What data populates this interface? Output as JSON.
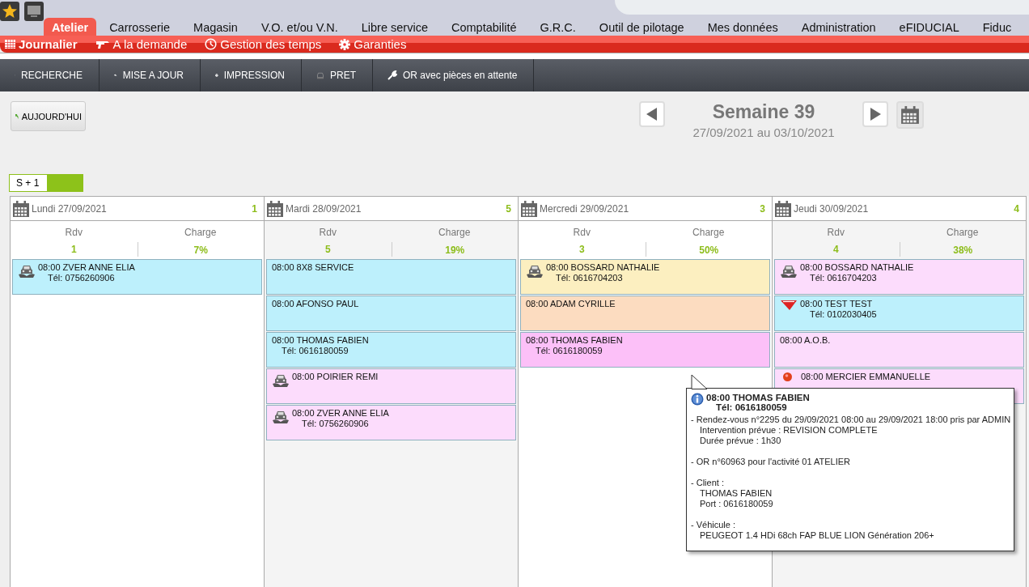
{
  "main_tabs": [
    {
      "label": "Atelier",
      "selected": true
    },
    {
      "label": "Carrosserie",
      "selected": false
    },
    {
      "label": "Magasin",
      "selected": false
    },
    {
      "label": "V.O. et/ou V.N.",
      "selected": false
    },
    {
      "label": "Libre service",
      "selected": false
    },
    {
      "label": "Comptabilité",
      "selected": false
    },
    {
      "label": "G.R.C.",
      "selected": false
    },
    {
      "label": "Outil de pilotage",
      "selected": false
    },
    {
      "label": "Mes données",
      "selected": false
    },
    {
      "label": "Administration",
      "selected": false
    },
    {
      "label": "eFIDUCIAL",
      "selected": false
    },
    {
      "label": "Fiduc",
      "selected": false
    }
  ],
  "sub_tabs": [
    {
      "label": "Journalier",
      "selected": true
    },
    {
      "label": "A la demande",
      "selected": false
    },
    {
      "label": "Gestion des temps",
      "selected": false
    },
    {
      "label": "Garanties",
      "selected": false
    }
  ],
  "toolbar": [
    "RECHERCHE",
    "MISE A JOUR",
    "IMPRESSION",
    "PRET",
    "OR avec pièces en attente"
  ],
  "today_button": "AUJOURD'HUI",
  "week": {
    "title": "Semaine 39",
    "range": "27/09/2021 au 03/10/2021"
  },
  "week_offset": "S + 1",
  "days": [
    {
      "date": "Lundi 27/09/2021",
      "count": "1",
      "rdv_label": "Rdv",
      "rdv": "1",
      "charge_label": "Charge",
      "charge": "7%",
      "appointments": [
        {
          "title": "08:00 ZVER ANNE ELIA",
          "phone": "Tél: 0756260906",
          "kind": "car",
          "color": "#bdf0fc"
        }
      ]
    },
    {
      "date": "Mardi 28/09/2021",
      "count": "5",
      "rdv_label": "Rdv",
      "rdv": "5",
      "charge_label": "Charge",
      "charge": "19%",
      "appointments": [
        {
          "title": "08:00 8X8 SERVICE",
          "kind": "plain",
          "color": "#bdf0fc"
        },
        {
          "title": "08:00 AFONSO PAUL",
          "kind": "plain",
          "color": "#bdf0fc"
        },
        {
          "title": "08:00 THOMAS FABIEN",
          "phone": "Tél: 0616180059",
          "kind": "plain",
          "color": "#bdf0fc"
        },
        {
          "title": "08:00 POIRIER REMI",
          "kind": "car",
          "color": "#fcdcfc"
        },
        {
          "title": "08:00 ZVER ANNE ELIA",
          "phone": "Tél: 0756260906",
          "kind": "car",
          "color": "#fcdcfc"
        }
      ]
    },
    {
      "date": "Mercredi 29/09/2021",
      "count": "3",
      "rdv_label": "Rdv",
      "rdv": "3",
      "charge_label": "Charge",
      "charge": "50%",
      "appointments": [
        {
          "title": "08:00 BOSSARD NATHALIE",
          "phone": "Tél: 0616704203",
          "kind": "car",
          "color": "#fcefc0"
        },
        {
          "title": "08:00 ADAM CYRILLE",
          "kind": "plain",
          "color": "#fcdcc0"
        },
        {
          "title": "08:00 THOMAS FABIEN",
          "phone": "Tél: 0616180059",
          "kind": "plain",
          "color": "#fcc0f8"
        }
      ]
    },
    {
      "date": "Jeudi 30/09/2021",
      "count": "4",
      "rdv_label": "Rdv",
      "rdv": "4",
      "charge_label": "Charge",
      "charge": "38%",
      "appointments": [
        {
          "title": "08:00 BOSSARD NATHALIE",
          "phone": "Tél: 0616704203",
          "kind": "car",
          "color": "#fcdcfc"
        },
        {
          "title": "08:00 TEST TEST",
          "phone": "Tél: 0102030405",
          "kind": "badge",
          "color": "#bdf0fc"
        },
        {
          "title": "08:00 A.O.B.",
          "kind": "plain",
          "color": "#fcdcfc"
        },
        {
          "title": "08:00 MERCIER EMMANUELLE",
          "kind": "dot",
          "color": "#fcdcfc"
        }
      ]
    }
  ],
  "tooltip": {
    "title": "08:00 THOMAS FABIEN",
    "phone": "Tél: 0616180059",
    "sections": [
      [
        "- Rendez-vous n°2295 du 29/09/2021 08:00 au 29/09/2021 18:00 pris par ADMIN",
        "Intervention prévue : REVISION COMPLETE",
        "Durée prévue : 1h30"
      ],
      [
        "- OR n°60963 pour l'activité 01 ATELIER"
      ],
      [
        "- Client :",
        "THOMAS FABIEN",
        "Port : 0616180059"
      ],
      [
        "- Véhicule :",
        "PEUGEOT 1.4 HDi 68ch FAP BLUE LION Génération 206+"
      ]
    ]
  }
}
